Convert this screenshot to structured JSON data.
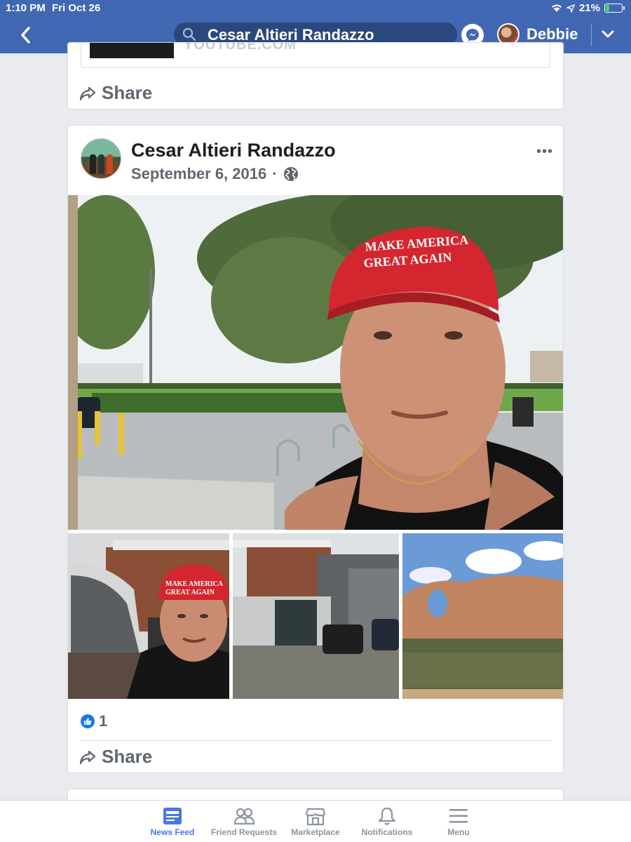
{
  "status_bar": {
    "time": "1:10 PM",
    "date": "Fri Oct 26",
    "battery": "21%",
    "battery_level": 0.21
  },
  "header": {
    "search_text": "Cesar Altieri Randazzo",
    "username": "Debbie",
    "icons": [
      "back-chevron-icon",
      "search-icon",
      "messenger-icon",
      "dropdown-chevron-icon"
    ],
    "bar_color": "#4267b2"
  },
  "prev_post": {
    "link_domain": "YOUTUBE.COM",
    "share_label": "Share"
  },
  "post": {
    "author": "Cesar Altieri Randazzo",
    "date": "September 6, 2016",
    "separator": "·",
    "privacy_icon": "globe-icon",
    "more_label": "•••",
    "hat_text": "MAKE AMERICA GREAT AGAIN",
    "photo_hat_text": [
      "MAKE AMERICA",
      "GREAT AGAIN"
    ],
    "like_count": "1",
    "share_label": "Share"
  },
  "tabbar": {
    "tabs": [
      {
        "label": "News Feed",
        "icon": "news-feed-icon",
        "active": true
      },
      {
        "label": "Friend Requests",
        "icon": "friends-icon",
        "active": false
      },
      {
        "label": "Marketplace",
        "icon": "marketplace-icon",
        "active": false
      },
      {
        "label": "Notifications",
        "icon": "bell-icon",
        "active": false
      },
      {
        "label": "Menu",
        "icon": "hamburger-icon",
        "active": false
      }
    ],
    "active_color": "#4a76e8"
  }
}
